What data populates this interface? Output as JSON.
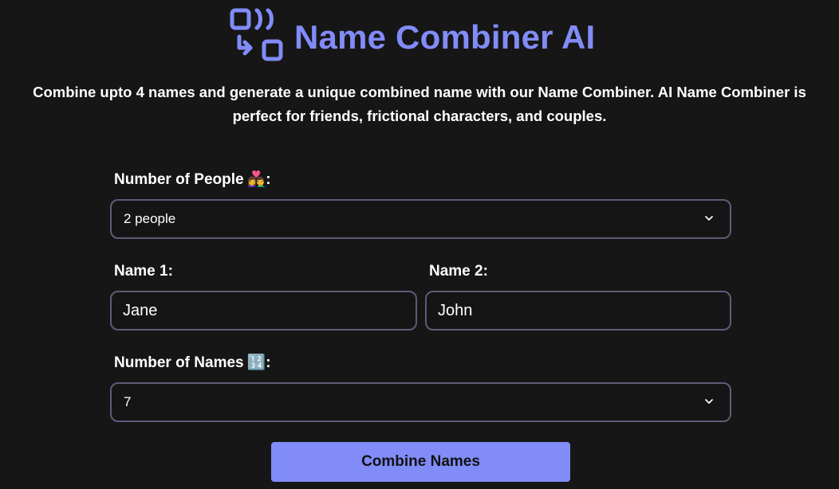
{
  "app": {
    "title": "Name Combiner AI",
    "description": "Combine upto 4 names and generate a unique combined name with our Name Combiner. AI Name Combiner is perfect for friends, frictional characters, and couples."
  },
  "form": {
    "people": {
      "label": "Number of People",
      "emoji": "👩‍❤️‍👨",
      "colon": ":",
      "value": "2 people"
    },
    "name1": {
      "label": "Name 1:",
      "value": "Jane"
    },
    "name2": {
      "label": "Name 2:",
      "value": "John"
    },
    "names_count": {
      "label": "Number of Names",
      "emoji": "🔢",
      "colon": ":",
      "value": "7"
    },
    "submit_label": "Combine Names"
  },
  "colors": {
    "accent": "#818cf8",
    "background": "#161616",
    "border": "#5f5b78"
  },
  "icons": {
    "logo": "combine-icon",
    "dropdown": "chevron-down-icon"
  }
}
